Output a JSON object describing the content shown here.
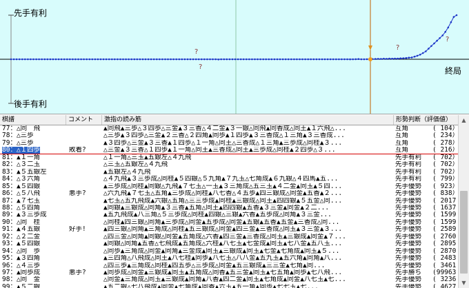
{
  "graph": {
    "label_sente": "先手有利",
    "label_gote": "後手有利",
    "label_end": "終局",
    "marker_q": "?",
    "series": [
      0,
      0,
      0,
      0,
      0,
      0,
      0,
      0,
      0,
      0,
      0,
      0,
      0,
      0,
      0,
      0,
      0,
      0,
      0,
      0,
      0,
      0,
      0,
      0,
      0,
      0,
      0,
      0,
      0,
      0,
      0,
      0,
      0,
      0,
      0,
      0,
      0,
      0,
      0,
      0,
      0,
      0,
      0,
      0,
      0,
      0,
      0,
      0,
      0,
      0,
      0,
      0,
      0,
      0,
      0,
      0,
      0,
      0,
      0,
      0,
      0,
      0,
      0,
      0,
      0,
      0,
      0,
      0,
      0,
      0,
      0,
      0,
      0,
      0,
      -20,
      0,
      0,
      0,
      0,
      0,
      0,
      0,
      0,
      0,
      0,
      0,
      0,
      0,
      0,
      0,
      0,
      0,
      0,
      0,
      0,
      0,
      0,
      0,
      0,
      0,
      0,
      0,
      0,
      0,
      0,
      0,
      0,
      0,
      0,
      0,
      0,
      0,
      0,
      0,
      0,
      0,
      0,
      0,
      0,
      0,
      0,
      -10,
      0,
      10,
      20,
      0,
      0,
      10,
      0,
      20,
      30,
      50,
      40,
      60,
      50,
      70,
      60,
      80,
      70,
      100,
      120,
      140,
      180,
      200,
      300,
      400,
      520,
      700,
      900,
      1200,
      1500,
      1800,
      2100,
      2400,
      2700,
      3100,
      3600,
      4200,
      4800,
      5000
    ],
    "colors": {
      "bg": "#d8fcfc",
      "line": "#1c35c8",
      "zero": "#000000",
      "cursor": "#c06000"
    }
  },
  "table": {
    "headers": {
      "move": "棋譜",
      "comment": "コメント",
      "line": "激指の読み筋",
      "judge": "形勢判断（評価値）"
    },
    "rows": [
      {
        "move": "77：△同　飛",
        "comment": "",
        "line": "▲同飛▲三歩△３四歩△三金▲３三香△４二金▲３一銀△同飛▲同香成△同王▲１六飛△...",
        "judge": "互角",
        "eval": "104）"
      },
      {
        "move": "78：△三歩",
        "comment": "",
        "line": "△三歩▲３四歩△三金▲２三香△２四角▲同歩▲１四歩▲３三香成△１三角▲３三香成...",
        "judge": "互角",
        "eval": "234）"
      },
      {
        "move": "79：△三歩",
        "comment": "",
        "line": "▲３四歩△三金▲３三香▲１四歩△１一角△同王△三香成△１三角▲三歩成△同桂▲３...",
        "judge": "互角",
        "eval": "278）"
      },
      {
        "move": "80：△１四歩",
        "comment": "敗着?",
        "line": "△三金▲３三香△１四歩▲１一角△同王▲三香成△同王▲三歩成△同桂▲２四歩△３...",
        "judge": "互角",
        "eval": "216）"
      },
      {
        "move": "81：▲１一角",
        "comment": "",
        "line": "△１一角△三玉▲五銀左△４九飛",
        "judge": "先手有利",
        "eval": "702）"
      },
      {
        "move": "82：△３二玉",
        "comment": "",
        "line": "△三玉△五銀左△４九飛",
        "judge": "先手有利",
        "eval": "702）"
      },
      {
        "move": "83：▲５五銀左",
        "comment": "",
        "line": "▲五銀左△４九飛",
        "judge": "先手有利",
        "eval": "702）"
      },
      {
        "move": "84：△３六角",
        "comment": "",
        "line": "△４九飛▲３三歩成△同桂▲５四銀△５九角▲７九玉△七角成▲６九銀△４四馬▲五...",
        "judge": "先手有利",
        "eval": "799）"
      },
      {
        "move": "85：▲５四銀",
        "comment": "",
        "line": "▲三歩成△同桂▲同銀△九飛▲７七玉△一玉▲３三角成△五三玉▲４二金▲同玉▲５四...",
        "judge": "先手優勢",
        "eval": "923）"
      },
      {
        "move": "86：△５八飛",
        "comment": "悪手?",
        "line": "△六九飛▲７七玉△五角▲三歩成△同桂▲八七香△４五歩▲四三銀成△同金▲五香▲２...",
        "judge": "先手優勢",
        "eval": "838）"
      },
      {
        "move": "87：▲７七玉",
        "comment": "",
        "line": "▲七玉△五九飛成▲六銀△五角△三三歩成▲同桂▲三銀成△同王▲四四銀▲５五金△同...",
        "judge": "先手優勢",
        "eval": "2017）"
      },
      {
        "move": "88：△５四角",
        "comment": "",
        "line": "▲同銀▲三銀成△同角▲３三香▲五角△同王▲四四銀▲五香▲３三金▲同金▲２二...",
        "judge": "先手優勢",
        "eval": "1637）"
      },
      {
        "move": "89：▲３三歩成",
        "comment": "",
        "line": "▲五九飛成▲八三角△５三歩成△同桂▲四銀△三銀▲六香▲五歩成△同角▲３三金...",
        "judge": "先手優勢",
        "eval": "1599）"
      },
      {
        "move": "90：△同　桂",
        "comment": "",
        "line": "△同桂▲四三銀△同角▲三歩成△同金▲五歩成△同金▲五銀▲五香▲五金▲三香成△同...",
        "judge": "先手優勢",
        "eval": "1599）"
      },
      {
        "move": "91：▲４五銀",
        "comment": "好手!",
        "line": "▲四三銀△同角▲三角成△同桂▲五三銀成△同金▲四三金▲三香成△同玉▲３三金▲３...",
        "judge": "先手優勢",
        "eval": "2589）"
      },
      {
        "move": "92：△２二金",
        "comment": "",
        "line": "△四三金△同角▲同銀△同金▲五角成△六香▲四三金▲三香成△同玉▲三銀成▲同金▲７...",
        "judge": "先手優勢",
        "eval": "2760）"
      },
      {
        "move": "93：▲５四銀",
        "comment": "",
        "line": "▲同銀△同角▲五香△七飛成▲五角成△六桂▲八七玉▲七金成▲同玉▲七八金▲五八玉...",
        "judge": "先手優勢",
        "eval": "2895）"
      },
      {
        "move": "94：△同　歩",
        "comment": "",
        "line": "△同歩▲三角成△同金▲同角▲三金成▲同玉▲三銀成▲同玉▲七金▲七角成▲同玉▲５...",
        "judge": "先手優勢",
        "eval": "2870）"
      },
      {
        "move": "95：▲３四角",
        "comment": "",
        "line": "▲三四角△八飛成△同王▲八七桂▲同歩▲八七玉△八八金▲五九玉▲五六角▲同角▲八...",
        "judge": "先手優勢",
        "eval": "2483）"
      },
      {
        "move": "96：△４三歩",
        "comment": "",
        "line": "△四三歩▲三角成△同桂▲四五歩△三歩成△同金▲五三銀成▲三三金▲七角▲同...",
        "judge": "先手優勢",
        "eval": "3461）"
      },
      {
        "move": "97：▲同歩成",
        "comment": "悪手?",
        "line": "▲同歩成△同金▲三銀成▲同玉▲五角成△同香▲五三金▲同玉▲七五角▲同歩▲七八飛...",
        "judge": "先手勝ち",
        "eval": "99963）"
      },
      {
        "move": "98：△同　金",
        "comment": "",
        "line": "△同金▲三角成△同玉▲三銀成▲同角▲八香▲四二金▲同玉▲七角成▲同金▲八七玉▲七...",
        "judge": "先手優勢",
        "eval": "3236）"
      },
      {
        "move": "99：▲５二銀",
        "comment": "",
        "line": "▲五二銀△七八飛成▲同金▲七角成▲同香▲六玉▲五一角▲同歩▲七七玉▲七...",
        "judge": "先手優勢",
        "eval": "4627）"
      }
    ],
    "selected_index": 3
  }
}
